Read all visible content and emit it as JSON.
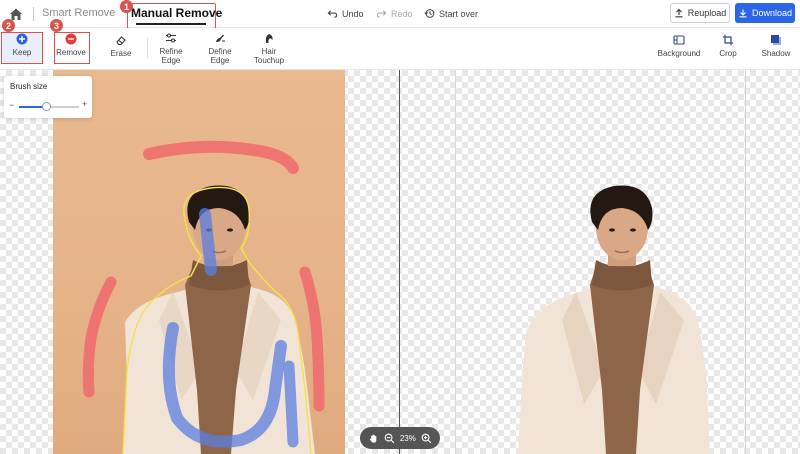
{
  "header": {
    "modes": {
      "smart": "Smart Remove",
      "manual": "Manual Remove"
    },
    "actions": {
      "undo": "Undo",
      "redo": "Redo",
      "start_over": "Start over"
    },
    "buttons": {
      "reupload": "Reupload",
      "download": "Download"
    }
  },
  "toolbar": {
    "keep": "Keep",
    "remove": "Remove",
    "erase": "Erase",
    "refine_edge_1": "Refine",
    "refine_edge_2": "Edge",
    "define_edge_1": "Define",
    "define_edge_2": "Edge",
    "hair_1": "Hair",
    "hair_2": "Touchup",
    "background": "Background",
    "crop": "Crop",
    "shadow": "Shadow"
  },
  "brush": {
    "title": "Brush size",
    "minus": "−",
    "plus": "+",
    "level": 0.45
  },
  "zoom": {
    "value": "23%"
  },
  "badges": {
    "one": "1",
    "two": "2",
    "three": "3"
  },
  "colors": {
    "accent": "#2b66e6",
    "annotation": "#d9534f",
    "remove_stroke": "#ef6f6f",
    "keep_stroke": "#5b7fe0",
    "selection_outline": "#f3e24a"
  }
}
